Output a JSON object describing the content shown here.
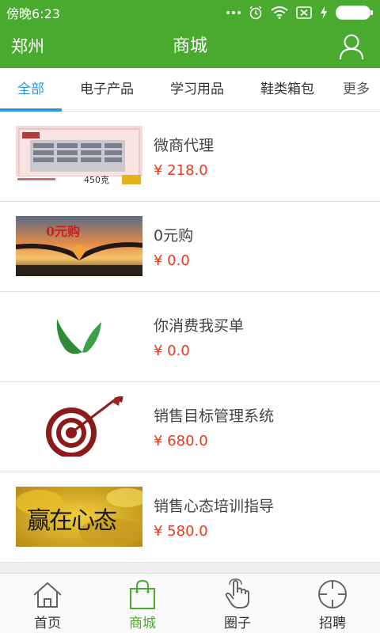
{
  "status_bar": {
    "time": "傍晚6:23",
    "icons": [
      "more-dots-icon",
      "alarm-icon",
      "wifi-icon",
      "sim-icon",
      "charging-icon",
      "battery-icon"
    ]
  },
  "header": {
    "city": "郑州",
    "title": "商城",
    "user_icon": "user-icon"
  },
  "tabs": [
    {
      "label": "全部",
      "active": true
    },
    {
      "label": "电子产品",
      "active": false
    },
    {
      "label": "学习用品",
      "active": false
    },
    {
      "label": "鞋类箱包",
      "active": false
    },
    {
      "label": "更多",
      "active": false
    }
  ],
  "products": [
    {
      "name": "微商代理",
      "price": "¥ 218.0",
      "thumb_text": "450克"
    },
    {
      "name": "0元购",
      "price": "¥ 0.0",
      "thumb_text": "0元购"
    },
    {
      "name": "你消费我买单",
      "price": "¥ 0.0"
    },
    {
      "name": "销售目标管理系统",
      "price": "¥ 680.0"
    },
    {
      "name": "销售心态培训指导",
      "price": "¥ 580.0",
      "thumb_text": "赢在心态"
    }
  ],
  "bottom_nav": [
    {
      "label": "首页",
      "icon": "home-icon",
      "active": false
    },
    {
      "label": "商城",
      "icon": "shopping-bag-icon",
      "active": true
    },
    {
      "label": "圈子",
      "icon": "hand-pointer-icon",
      "active": false
    },
    {
      "label": "招聘",
      "icon": "crosshair-icon",
      "active": false
    }
  ],
  "colors": {
    "brand_green": "#4aaa2f",
    "tab_active_blue": "#2f96e6",
    "price_red": "#e8391d"
  }
}
